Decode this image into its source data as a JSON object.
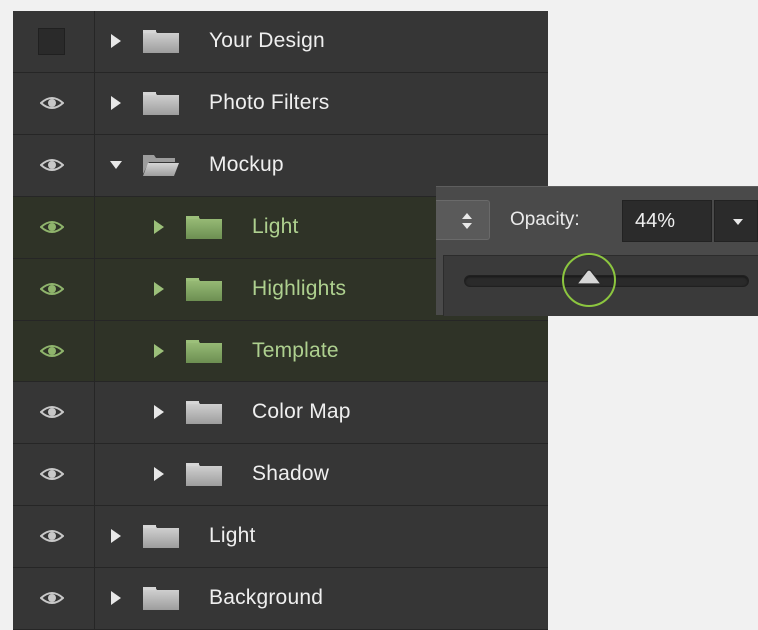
{
  "layers": [
    {
      "name": "Your Design",
      "visible": false,
      "indent": 0,
      "expanded": false,
      "selected": false
    },
    {
      "name": "Photo Filters",
      "visible": true,
      "indent": 0,
      "expanded": false,
      "selected": false
    },
    {
      "name": "Mockup",
      "visible": true,
      "indent": 0,
      "expanded": true,
      "selected": false
    },
    {
      "name": "Light",
      "visible": true,
      "indent": 1,
      "expanded": false,
      "selected": true
    },
    {
      "name": "Highlights",
      "visible": true,
      "indent": 1,
      "expanded": false,
      "selected": true
    },
    {
      "name": "Template",
      "visible": true,
      "indent": 1,
      "expanded": false,
      "selected": true
    },
    {
      "name": "Color Map",
      "visible": true,
      "indent": 1,
      "expanded": false,
      "selected": false
    },
    {
      "name": "Shadow",
      "visible": true,
      "indent": 1,
      "expanded": false,
      "selected": false
    },
    {
      "name": "Light",
      "visible": true,
      "indent": 0,
      "expanded": false,
      "selected": false
    },
    {
      "name": "Background",
      "visible": true,
      "indent": 0,
      "expanded": false,
      "selected": false
    }
  ],
  "opacity": {
    "label": "Opacity:",
    "value": "44%",
    "slider_fraction": 0.44
  },
  "icons": {
    "visibility": "eye-icon",
    "hidden": "visibility-box",
    "collapsed": "triangle-right-icon",
    "expanded": "triangle-down-icon",
    "group": "folder-icon",
    "open_group": "folder-open-icon",
    "stepper": "up-down-arrows-icon",
    "dropdown": "chevron-down-icon",
    "thumb": "slider-thumb-icon"
  },
  "colors": {
    "panel": "#363636",
    "selected_row": "#2f3327",
    "selected_text": "#aed08f",
    "normal_text": "#efefef",
    "accent_ring": "#8cc63f"
  }
}
